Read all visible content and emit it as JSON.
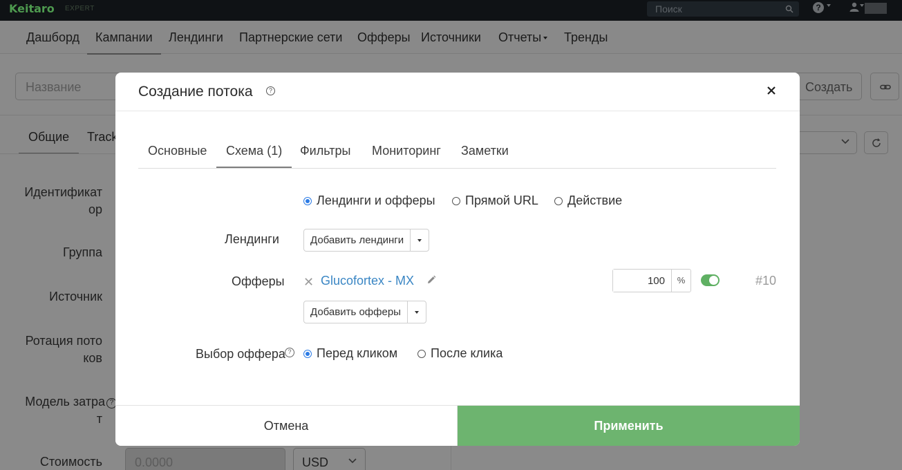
{
  "colors": {
    "accent_green": "#6db46f",
    "link_blue": "#3a86c4",
    "radio_blue": "#2c7be5",
    "topbar": "#0f1215"
  },
  "topbar": {
    "logo": "Keitaro",
    "edition": "EXPERT",
    "search_placeholder": "Поиск",
    "help_icon": "question-icon",
    "user_icon": "user-icon"
  },
  "nav": {
    "items": [
      "Дашборд",
      "Кампании",
      "Лендинги",
      "Партнерские сети",
      "Офферы",
      "Источники",
      "Отчеты",
      "Тренды"
    ],
    "active": "Кампании"
  },
  "background": {
    "filter_placeholder": "Название",
    "create_label": "Создать",
    "tabs": [
      "Общие",
      "Track"
    ],
    "labels": {
      "id_1": "Идентификат",
      "id_2": "ор",
      "group": "Группа",
      "source": "Источник",
      "rotation_1": "Ротация пото",
      "rotation_2": "ков",
      "cost_model_1": "Модель затра",
      "cost_model_2": "т",
      "cost": "Стоимость"
    },
    "cost_value": "0.0000",
    "currency": "USD"
  },
  "modal": {
    "title": "Создание потока",
    "tabs": [
      "Основные",
      "Схема (1)",
      "Фильтры",
      "Мониторинг",
      "Заметки"
    ],
    "active_tab": "Схема (1)",
    "scheme_options": [
      "Лендинги и офферы",
      "Прямой URL",
      "Действие"
    ],
    "scheme_selected": "Лендинги и офферы",
    "landings_label": "Лендинги",
    "add_landings": "Добавить лендинги",
    "offers_label": "Офферы",
    "offer": {
      "name": "Glucofortex - MX",
      "weight": "100",
      "unit": "%",
      "enabled": true,
      "id": "#10"
    },
    "add_offers": "Добавить офферы",
    "offer_choice_label": "Выбор оффера",
    "offer_choice_options": [
      "Перед кликом",
      "После клика"
    ],
    "offer_choice_selected": "Перед кликом",
    "cancel": "Отмена",
    "apply": "Применить"
  }
}
